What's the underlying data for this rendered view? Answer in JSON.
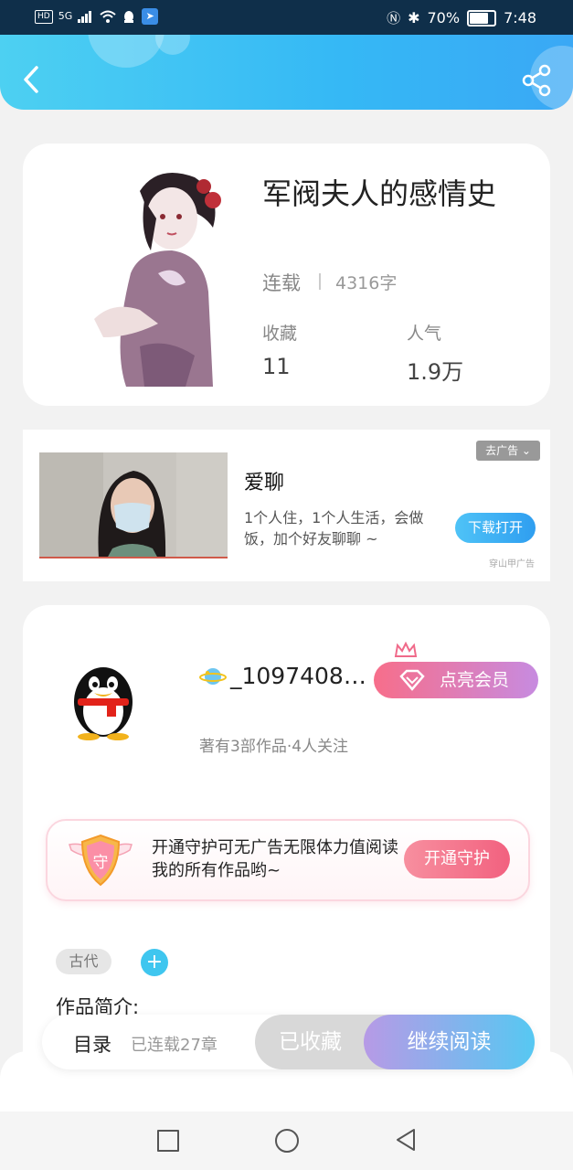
{
  "status_bar": {
    "hd": "HD",
    "network": "5G",
    "battery_text": "70%",
    "battery_level": 0.7,
    "time": "7:48"
  },
  "header": {
    "back_icon": "chevron-left-icon",
    "share_icon": "share-icon"
  },
  "book": {
    "title": "军阀夫人的感情史",
    "status": "连载",
    "word_count": "4316字",
    "favorites_label": "收藏",
    "favorites_value": "11",
    "popularity_label": "人气",
    "popularity_value": "1.9万"
  },
  "ad": {
    "title": "爱聊",
    "description": "1个人住，1个人生活，会做饭，加个好友聊聊 ~",
    "remove_label": "去广告 ⌄",
    "button_label": "下载打开",
    "source": "穿山甲广告"
  },
  "author": {
    "name": "_1097408…",
    "meta": "著有3部作品·4人关注",
    "vip_button": "点亮会员",
    "guard_text": "开通守护可无广告无限体力值阅读我的所有作品哟~",
    "guard_shield_char": "守",
    "guard_button": "开通守护",
    "tag": "古代",
    "tag_add": "+",
    "intro_label": "作品简介:"
  },
  "actions": {
    "catalog": "目录",
    "chapters": "已连载27章",
    "collected": "已收藏",
    "continue": "继续阅读"
  },
  "colors": {
    "header_start": "#4dd0f2",
    "header_end": "#3aa8f5",
    "accent_blue": "#3fc6ef",
    "vip_pink": "#f76e8a",
    "guard_pink": "#f2617f"
  }
}
